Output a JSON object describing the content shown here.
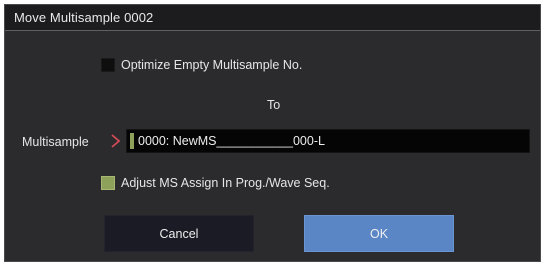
{
  "dialog": {
    "title": "Move Multisample 0002"
  },
  "options": {
    "optimize_label": "Optimize Empty Multisample No.",
    "optimize_checked": false,
    "to_label": "To",
    "adjust_label": "Adjust MS Assign In Prog./Wave Seq.",
    "adjust_checked": true
  },
  "multisample": {
    "label": "Multisample",
    "chevron_icon": "chevron-right-icon",
    "value": "0000: NewMS___________000-L"
  },
  "buttons": {
    "cancel_label": "Cancel",
    "ok_label": "OK"
  },
  "colors": {
    "dialog_bg": "#2b2b2d",
    "accent_green": "#8ea15a",
    "ok_blue": "#5b86c6",
    "chevron_red": "#d24a55"
  }
}
